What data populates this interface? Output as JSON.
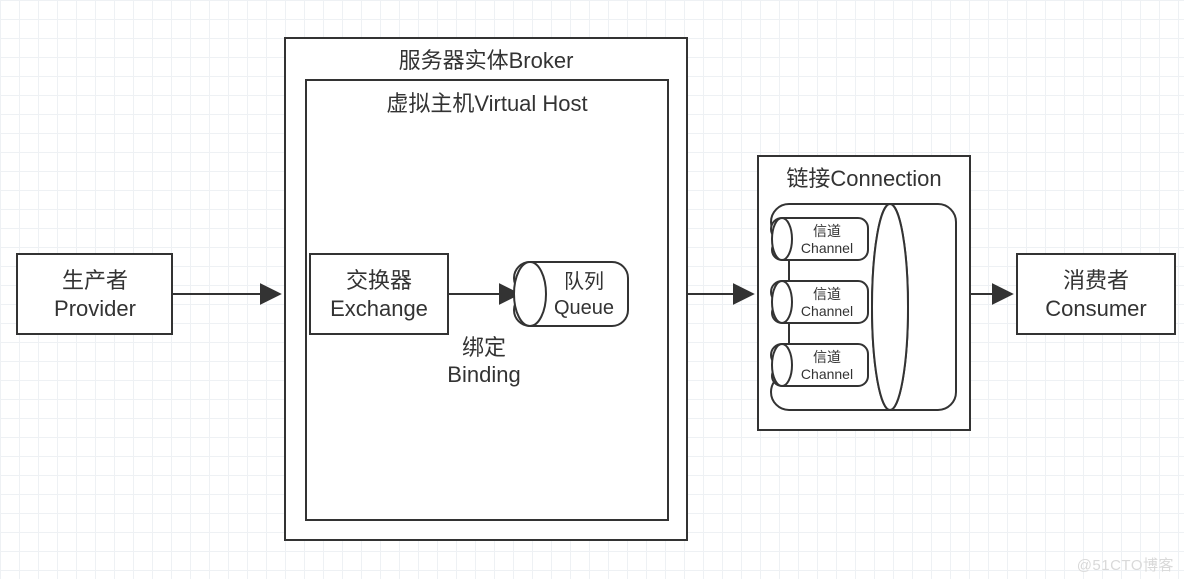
{
  "diagram": {
    "producer": {
      "line1": "生产者",
      "line2": "Provider"
    },
    "broker": {
      "title": "服务器实体Broker"
    },
    "vhost": {
      "title": "虚拟主机Virtual Host"
    },
    "exchange": {
      "line1": "交换器",
      "line2": "Exchange"
    },
    "binding": {
      "line1": "绑定",
      "line2": "Binding"
    },
    "queue": {
      "line1": "队列",
      "line2": "Queue"
    },
    "connection": {
      "title": "链接Connection",
      "channels": [
        {
          "line1": "信道",
          "line2": "Channel"
        },
        {
          "line1": "信道",
          "line2": "Channel"
        },
        {
          "line1": "信道",
          "line2": "Channel"
        }
      ]
    },
    "consumer": {
      "line1": "消费者",
      "line2": "Consumer"
    }
  },
  "watermark": "@51CTO博客"
}
